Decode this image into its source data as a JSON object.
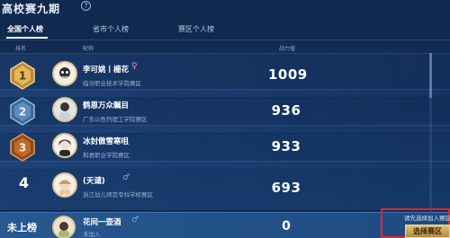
{
  "header": {
    "title": "高校赛九期",
    "help_icon": "question-icon"
  },
  "tabs": [
    {
      "label": "全国个人榜",
      "active": true
    },
    {
      "label": "省市个人榜",
      "active": false
    },
    {
      "label": "赛区个人榜",
      "active": false
    }
  ],
  "columns": {
    "rank": "排名",
    "nickname": "昵称",
    "power": "战力值"
  },
  "rows": [
    {
      "rank": "1",
      "name": "李可姚丨栅花",
      "school": "临汾职业技术学院赛区",
      "gender": "female",
      "gender_symbol": "♀",
      "score": "1009"
    },
    {
      "rank": "2",
      "name": "鹤恩万众瞩目",
      "school": "广东以色列理工学院赛区",
      "gender": "",
      "gender_symbol": "",
      "score": "936"
    },
    {
      "rank": "3",
      "name": "冰封傲雪寒咀",
      "school": "和君职业学院赛区",
      "gender": "",
      "gender_symbol": "",
      "score": "933"
    },
    {
      "rank": "4",
      "name": "(天谴)",
      "school": "浙江幼儿师范专科学校赛区",
      "gender": "male",
      "gender_symbol": "♂",
      "score": "693"
    }
  ],
  "self_row": {
    "rank": "未上榜",
    "name": "花间一壶酒",
    "gender_symbol": "♂",
    "sub": "未加入",
    "score": "0"
  },
  "notice": {
    "text": "请先选择加入赛区",
    "button_label": "选择赛区"
  },
  "colors": {
    "gold": "#e0b35c",
    "silver": "#8fb7e0",
    "bronze": "#d07a3a",
    "highlight_box": "#e1262c"
  }
}
